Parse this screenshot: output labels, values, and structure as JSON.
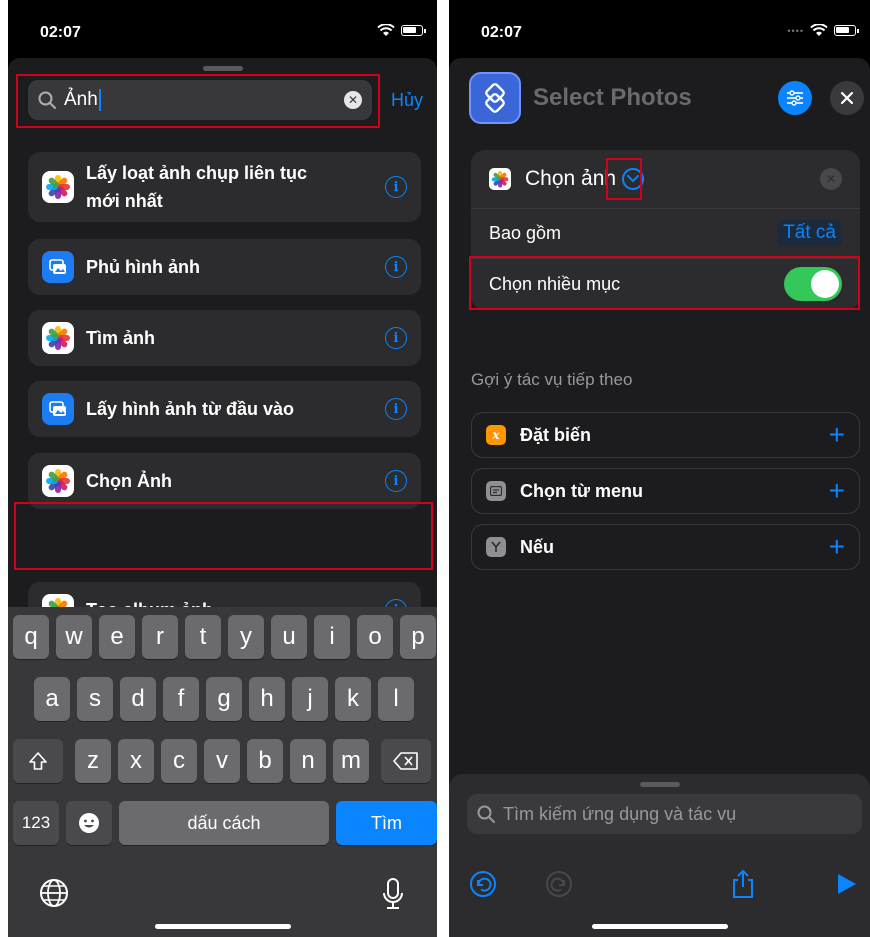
{
  "left_phone": {
    "status_time": "02:07",
    "search": {
      "value": "Ảnh",
      "cancel_label": "Hủy"
    },
    "results": [
      {
        "label_line1": "Lấy loạt ảnh chụp liên tục",
        "label_line2": "mới nhất",
        "icon": "photos-app-icon"
      },
      {
        "label": "Phủ hình ảnh",
        "icon": "overlay-image-icon"
      },
      {
        "label": "Tìm ảnh",
        "icon": "photos-app-icon"
      },
      {
        "label": "Lấy hình ảnh từ đầu vào",
        "icon": "overlay-image-icon"
      },
      {
        "label": "Chọn Ảnh",
        "icon": "photos-app-icon"
      },
      {
        "label": "Tạo album ảnh",
        "icon": "photos-app-icon"
      }
    ],
    "keyboard": {
      "row1": [
        "q",
        "w",
        "e",
        "r",
        "t",
        "y",
        "u",
        "i",
        "o",
        "p"
      ],
      "row2": [
        "a",
        "s",
        "d",
        "f",
        "g",
        "h",
        "j",
        "k",
        "l"
      ],
      "row3": [
        "z",
        "x",
        "c",
        "v",
        "b",
        "n",
        "m"
      ],
      "numbers_key": "123",
      "space_key": "dấu cách",
      "search_key": "Tìm"
    }
  },
  "right_phone": {
    "status_time": "02:07",
    "title": "Select Photos",
    "action": {
      "name": "Chọn ảnh",
      "include_label": "Bao gồm",
      "include_value": "Tất cả",
      "multi_label": "Chọn nhiều mục",
      "multi_enabled": true
    },
    "suggestions_heading": "Gợi ý tác vụ tiếp theo",
    "suggestions": [
      {
        "label": "Đặt biến",
        "icon": "variable-icon",
        "color": "#ff9500"
      },
      {
        "label": "Chọn từ menu",
        "icon": "menu-icon",
        "color": "#8e8e93"
      },
      {
        "label": "Nếu",
        "icon": "if-icon",
        "color": "#8e8e93"
      }
    ],
    "search_placeholder": "Tìm kiếm ứng dụng và tác vụ"
  },
  "colors": {
    "accent": "#0a84ff",
    "toggle_on": "#34c759",
    "highlight": "#d0021b"
  }
}
